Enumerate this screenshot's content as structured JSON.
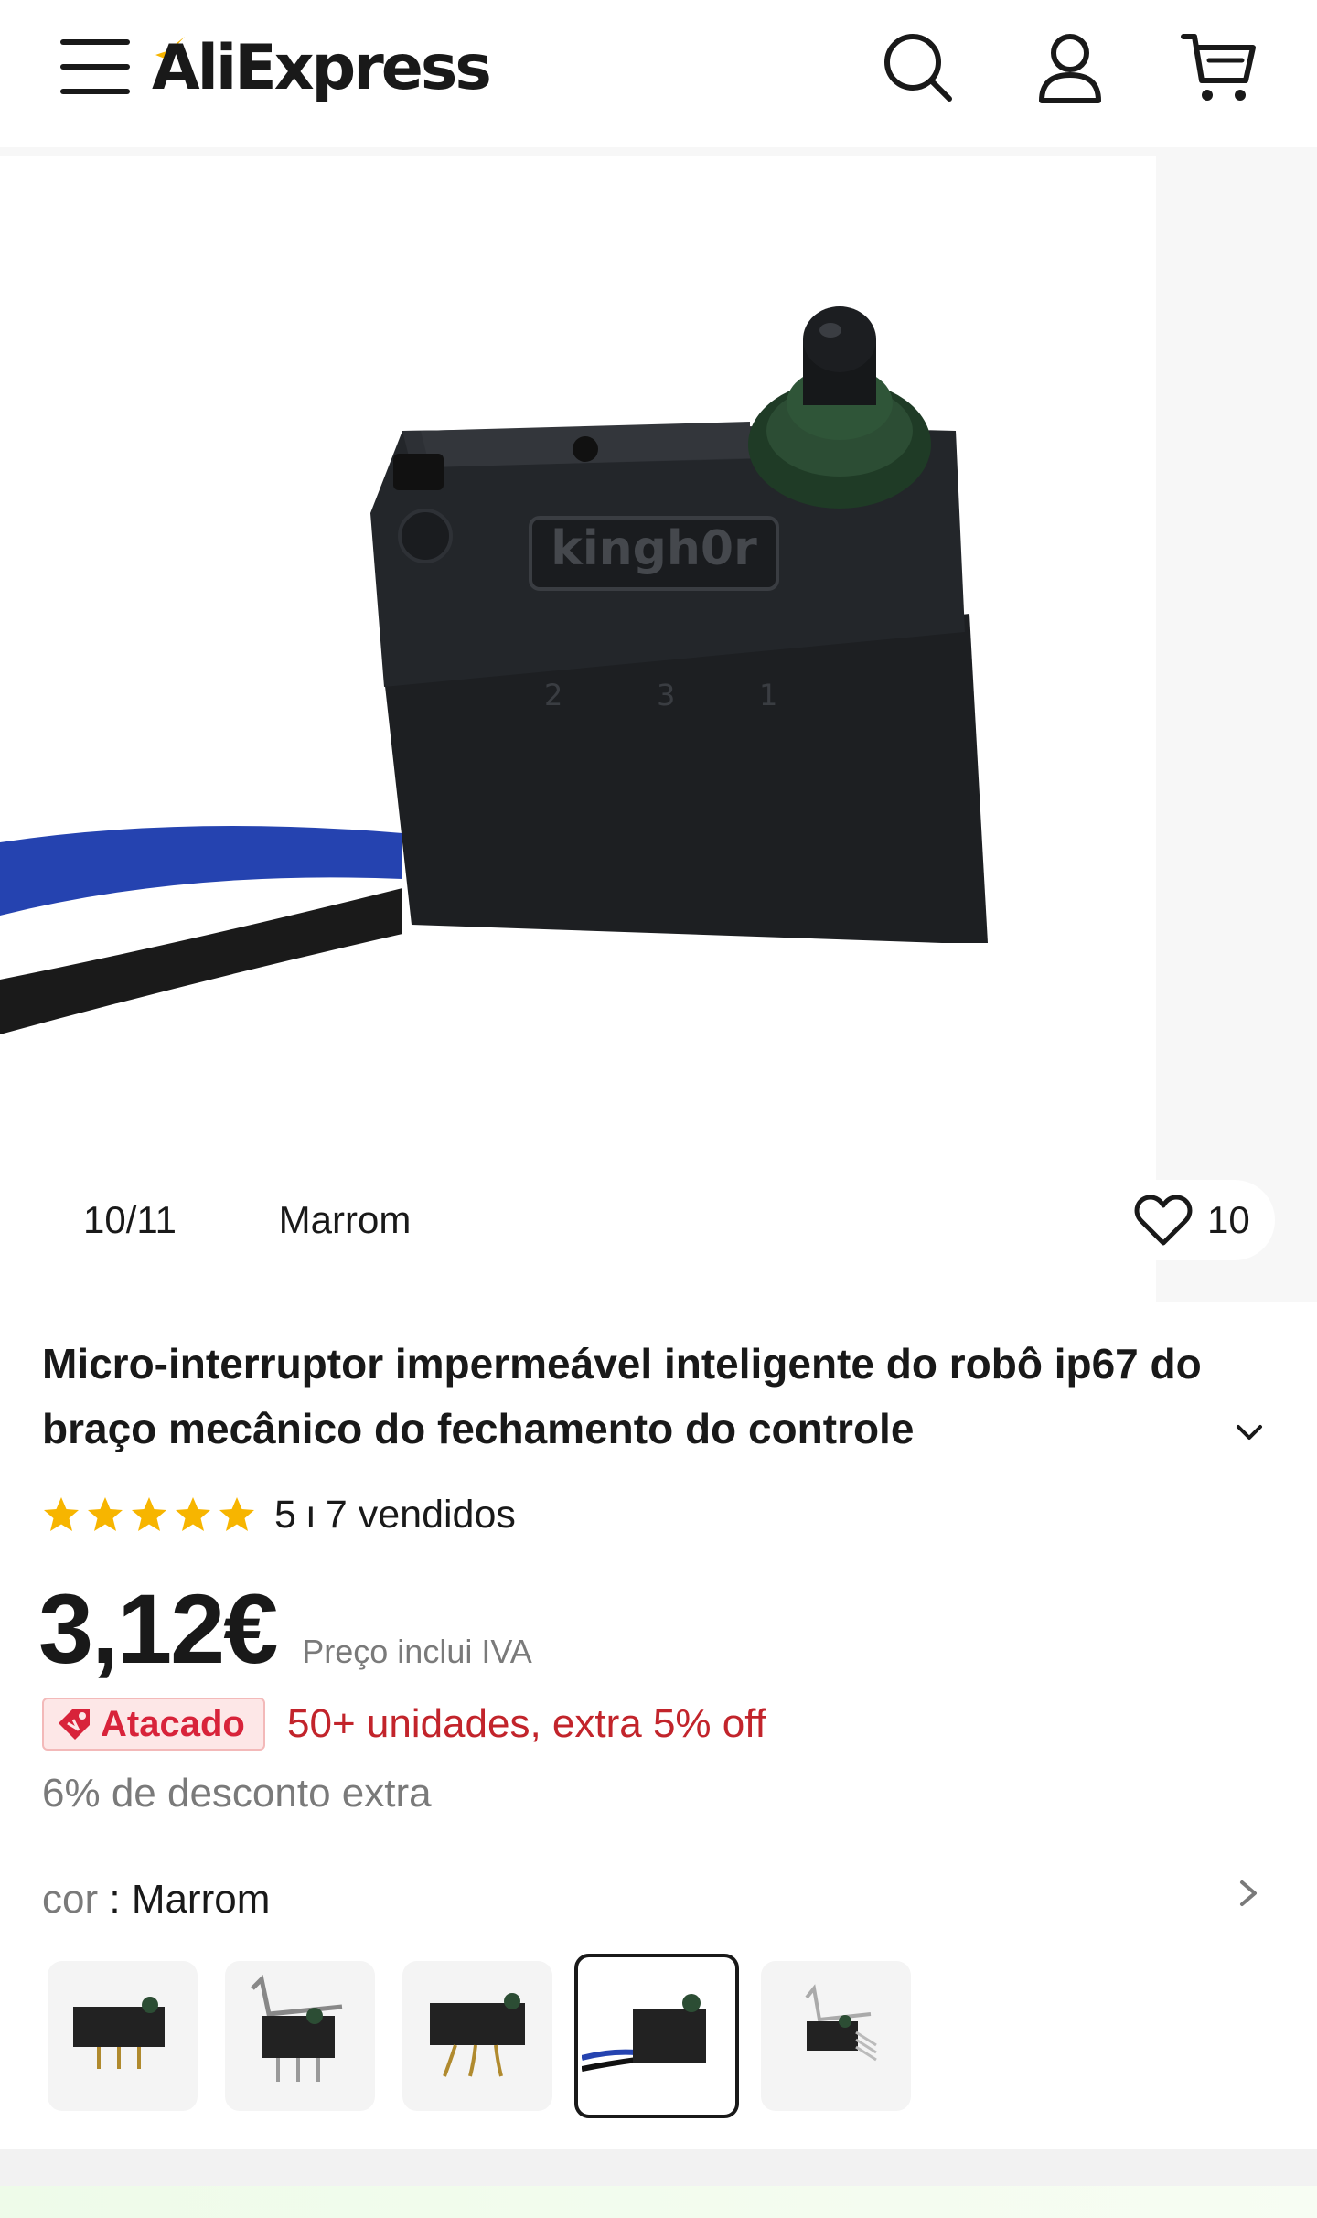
{
  "header": {
    "logo_text": "AliExpress",
    "icons": [
      "menu-icon",
      "search-icon",
      "account-icon",
      "cart-icon"
    ]
  },
  "gallery": {
    "counter": "10/11",
    "color_label": "Marrom",
    "wishlist_count": "10",
    "product_brand_marking": "kingh0r"
  },
  "product": {
    "title": "Micro-interruptor impermeável inteligente do robô ip67 do braço mecânico do fechamento do controle",
    "rating": "5",
    "rating_separator": "ı",
    "sold": "7 vendidos",
    "price": "3,12€",
    "tax_note": "Preço inclui IVA",
    "wholesale_badge": "Atacado",
    "wholesale_text": "50+ unidades, extra 5% off",
    "extra_discount": "6% de desconto extra",
    "color_label": "cor",
    "color_value": "Marrom",
    "stars_count": 5
  },
  "colors": {
    "brand_red": "#d8233a",
    "promo_red": "#c2242b",
    "star_yellow": "#f7b500",
    "muted_text": "#7a7a7a",
    "text": "#191919"
  },
  "swatches": [
    {
      "name": "variant-1",
      "selected": false
    },
    {
      "name": "variant-2",
      "selected": false
    },
    {
      "name": "variant-3",
      "selected": false
    },
    {
      "name": "variant-4",
      "selected": true
    },
    {
      "name": "variant-5",
      "selected": false
    }
  ]
}
